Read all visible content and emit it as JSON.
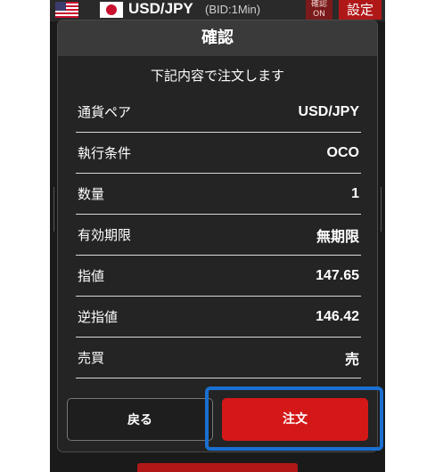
{
  "topbar": {
    "pair": "USD/JPY",
    "price_type": "(BID:1Min)",
    "confirm_toggle": {
      "line1": "確認",
      "line2": "ON"
    },
    "settings_label": "設定",
    "base_flag_icon": "us-flag-icon",
    "quote_flag_icon": "jp-flag-icon"
  },
  "dialog": {
    "title": "確認",
    "message": "下記内容で注文します",
    "rows": [
      {
        "label": "通貨ペア",
        "value": "USD/JPY"
      },
      {
        "label": "執行条件",
        "value": "OCO"
      },
      {
        "label": "数量",
        "value": "1"
      },
      {
        "label": "有効期限",
        "value": "無期限"
      },
      {
        "label": "指値",
        "value": "147.65"
      },
      {
        "label": "逆指値",
        "value": "146.42"
      },
      {
        "label": "売買",
        "value": "売"
      }
    ],
    "back_label": "戻る",
    "order_label": "注文"
  },
  "colors": {
    "accent_red": "#d41818",
    "highlight_blue": "#1a6fd1",
    "dialog_bg": "#242424"
  }
}
